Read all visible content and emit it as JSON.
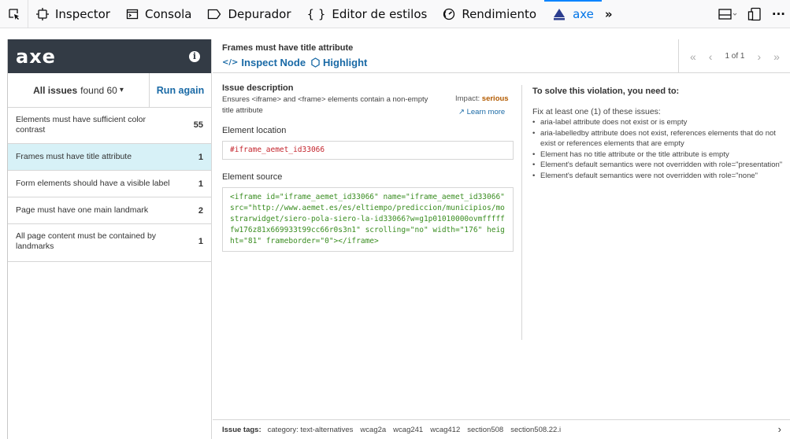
{
  "toolbar": {
    "tabs": [
      {
        "label": "Inspector",
        "icon": "inspector-icon"
      },
      {
        "label": "Consola",
        "icon": "console-icon"
      },
      {
        "label": "Depurador",
        "icon": "debugger-icon"
      },
      {
        "label": "Editor de estilos",
        "icon": "style-editor-icon"
      },
      {
        "label": "Rendimiento",
        "icon": "performance-icon"
      },
      {
        "label": "axe",
        "icon": "axe-icon"
      }
    ],
    "more": "»",
    "menu": "···"
  },
  "sidebar": {
    "logo": "axe",
    "info": "i",
    "filter_strong": "All issues",
    "filter_text": "found 60",
    "filter_arrow": "▾",
    "run_again": "Run again",
    "issues": [
      {
        "title": "Elements must have sufficient color contrast",
        "count": "55"
      },
      {
        "title": "Frames must have title attribute",
        "count": "1"
      },
      {
        "title": "Form elements should have a visible label",
        "count": "1"
      },
      {
        "title": "Page must have one main landmark",
        "count": "2"
      },
      {
        "title": "All page content must be contained by landmarks",
        "count": "1"
      }
    ]
  },
  "main": {
    "title": "Frames must have title attribute",
    "inspect_node": "Inspect Node",
    "highlight": "Highlight",
    "pager": {
      "first": "«",
      "prev": "‹",
      "text": "1 of 1",
      "next": "›",
      "last": "»"
    },
    "issue_description_label": "Issue description",
    "issue_description": "Ensures <iframe> and <frame> elements contain a non-empty title attribute",
    "impact_label": "Impact:",
    "impact_value": "serious",
    "learn_more": "Learn more",
    "element_location_label": "Element location",
    "element_location": "#iframe_aemet_id33066",
    "element_source_label": "Element source",
    "element_source": "<iframe id=\"iframe_aemet_id33066\" name=\"iframe_aemet_id33066\" src=\"http://www.aemet.es/es/eltiempo/prediccion/municipios/mostrarwidget/siero-pola-siero-la-id33066?w=g1p01010000ovmffffffw176z81x669933t99cc66r0s3n1\" scrolling=\"no\" width=\"176\" height=\"81\" frameborder=\"0\"></iframe>",
    "solve_title": "To solve this violation, you need to:",
    "fix_intro": "Fix at least one (1) of these issues:",
    "fixes": [
      "aria-label attribute does not exist or is empty",
      "aria-labelledby attribute does not exist, references elements that do not exist or references elements that are empty",
      "Element has no title attribute or the title attribute is empty",
      "Element's default semantics were not overridden with role=\"presentation\"",
      "Element's default semantics were not overridden with role=\"none\""
    ],
    "tags_label": "Issue tags:",
    "tags": [
      "category: text-alternatives",
      "wcag2a",
      "wcag241",
      "wcag412",
      "section508",
      "section508.22.i"
    ],
    "tags_chevron": "›"
  }
}
